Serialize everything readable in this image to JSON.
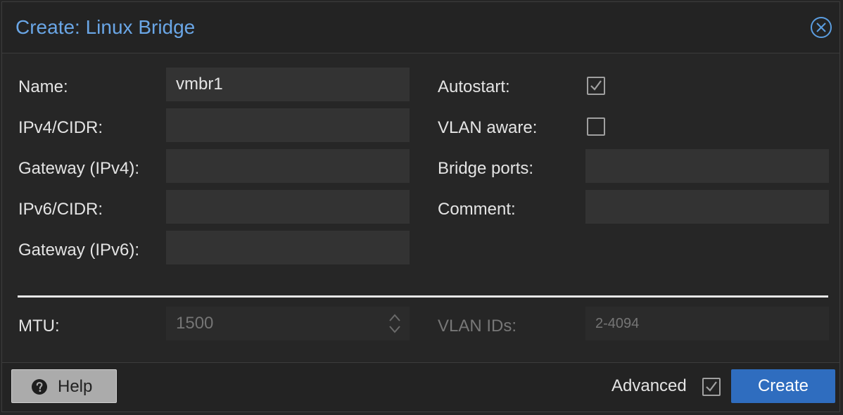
{
  "dialog": {
    "title": "Create: Linux Bridge"
  },
  "form": {
    "name": {
      "label": "Name:",
      "value": "vmbr1"
    },
    "ipv4": {
      "label": "IPv4/CIDR:",
      "value": ""
    },
    "gateway4": {
      "label": "Gateway (IPv4):",
      "value": ""
    },
    "ipv6": {
      "label": "IPv6/CIDR:",
      "value": ""
    },
    "gateway6": {
      "label": "Gateway (IPv6):",
      "value": ""
    },
    "autostart": {
      "label": "Autostart:",
      "checked": true
    },
    "vlan_aware": {
      "label": "VLAN aware:",
      "checked": false
    },
    "bridge_ports": {
      "label": "Bridge ports:",
      "value": ""
    },
    "comment": {
      "label": "Comment:",
      "value": ""
    }
  },
  "advanced": {
    "mtu": {
      "label": "MTU:",
      "placeholder": "1500"
    },
    "vlan_ids": {
      "label": "VLAN IDs:",
      "placeholder": "2-4094"
    }
  },
  "footer": {
    "help_label": "Help",
    "advanced_label": "Advanced",
    "advanced_checked": true,
    "create_label": "Create"
  },
  "icons": {
    "close": "close-circle-icon",
    "help": "question-circle-icon",
    "check": "checkmark-icon",
    "spinner": "up-down-chevron-icon"
  },
  "colors": {
    "title": "#6aa6e6",
    "primary_button": "#2f6dbf",
    "background": "#262626"
  }
}
